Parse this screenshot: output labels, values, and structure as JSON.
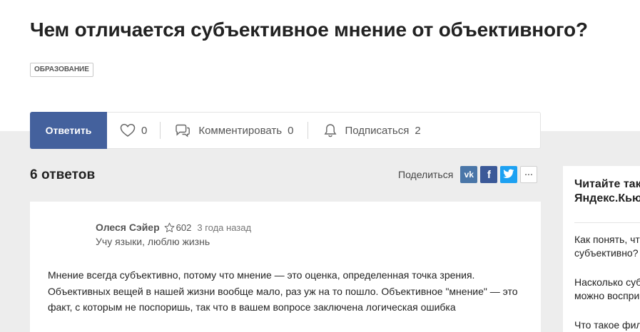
{
  "question": {
    "title": "Чем отличается субъективное мнение от объективного?",
    "tag": "ОБРАЗОВАНИЕ"
  },
  "actions": {
    "answer_label": "Ответить",
    "likes": "0",
    "comment_label": "Комментировать",
    "comments": "0",
    "subscribe_label": "Подписаться",
    "subscribers": "2"
  },
  "answers": {
    "count_label": "6 ответов"
  },
  "share": {
    "label": "Поделиться",
    "vk": "vk",
    "fb": "f",
    "more": "···"
  },
  "answer": {
    "author": "Олеся Сэйер",
    "rating": "602",
    "time": "3 года назад",
    "bio": "Учу языки, люблю жизнь",
    "text": "Мнение всегда субъективно, потому что мнение — это оценка, определенная точка зрения. Объективных вещей в нашей жизни вообще мало, раз уж на то пошло. Объективное \"мнение\" — это факт, с которым не поспоришь, так что в вашем вопросе заключена логическая ошибка"
  },
  "sidebar": {
    "title_line1": "Читайте также на",
    "title_line2": "Яндекс.Кью",
    "items": [
      {
        "line1": "Как понять, что мнение",
        "line2": "субъективно?"
      },
      {
        "line1": "Насколько субъективно",
        "line2": "можно воспринимать?"
      },
      {
        "line1": "Что такое философия?"
      }
    ]
  },
  "colors": {
    "primary": "#44619d",
    "vk": "#4a76a8",
    "facebook": "#3b5998",
    "twitter": "#1da1f2",
    "background": "#ededed"
  }
}
